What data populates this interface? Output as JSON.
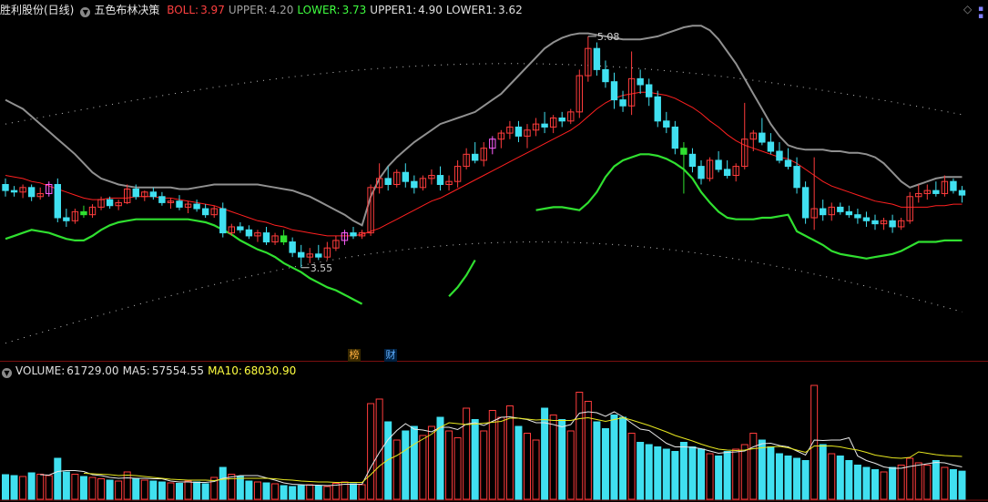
{
  "header": {
    "stock": "胜利股份(日线)",
    "indicator": "五色布林决策",
    "items": [
      {
        "label": "BOLL:",
        "value": "3.97",
        "color": "#ff4040"
      },
      {
        "label": "UPPER:",
        "value": "4.20",
        "color": "#a0a0a0"
      },
      {
        "label": "LOWER:",
        "value": "3.73",
        "color": "#40ff40"
      },
      {
        "label": "UPPER1:",
        "value": "4.90",
        "color": "#e0e0e0"
      },
      {
        "label": "LOWER1:",
        "value": "3.62",
        "color": "#e0e0e0"
      }
    ]
  },
  "volume_header": {
    "items": [
      {
        "label": "VOLUME:",
        "value": "61729.00",
        "color": "#e0e0e0"
      },
      {
        "label": "MA5:",
        "value": "57554.55",
        "color": "#e0e0e0"
      },
      {
        "label": "MA10:",
        "value": "68030.90",
        "color": "#ffff40"
      }
    ]
  },
  "badges": [
    "榜",
    "财"
  ],
  "colors": {
    "up": "#ff3c3c",
    "down": "#40e0f0",
    "ma": "#ff2020",
    "upper": "#909090",
    "lower": "#30e030",
    "vol_ma10": "#e8e820"
  },
  "chart_data": {
    "type": "candlestick",
    "annotations": {
      "high": "5.08",
      "low": "3.55"
    },
    "price_range": [
      3.0,
      5.2
    ],
    "candles": [
      [
        4.1,
        4.14,
        4.02,
        4.06
      ],
      [
        4.06,
        4.09,
        4.02,
        4.05
      ],
      [
        4.05,
        4.1,
        4.01,
        4.08
      ],
      [
        4.08,
        4.1,
        3.99,
        4.02
      ],
      [
        4.02,
        4.08,
        4.0,
        4.04
      ],
      [
        4.04,
        4.12,
        4.02,
        4.1
      ],
      [
        4.1,
        4.14,
        3.85,
        3.88
      ],
      [
        3.88,
        3.94,
        3.82,
        3.86
      ],
      [
        3.86,
        3.94,
        3.84,
        3.92
      ],
      [
        3.92,
        3.96,
        3.88,
        3.9
      ],
      [
        3.9,
        3.97,
        3.88,
        3.95
      ],
      [
        3.95,
        4.02,
        3.93,
        4.0
      ],
      [
        4.0,
        4.02,
        3.94,
        3.96
      ],
      [
        3.96,
        4.0,
        3.93,
        3.98
      ],
      [
        3.98,
        4.1,
        3.97,
        4.07
      ],
      [
        4.07,
        4.1,
        4.0,
        4.02
      ],
      [
        4.02,
        4.06,
        3.99,
        4.05
      ],
      [
        4.05,
        4.08,
        4.0,
        4.02
      ],
      [
        4.02,
        4.05,
        3.96,
        3.98
      ],
      [
        3.98,
        4.01,
        3.94,
        3.99
      ],
      [
        3.99,
        4.03,
        3.93,
        3.95
      ],
      [
        3.95,
        3.99,
        3.91,
        3.97
      ],
      [
        3.97,
        4.0,
        3.92,
        3.94
      ],
      [
        3.94,
        3.97,
        3.88,
        3.9
      ],
      [
        3.9,
        3.96,
        3.88,
        3.94
      ],
      [
        3.94,
        3.98,
        3.75,
        3.78
      ],
      [
        3.78,
        3.84,
        3.76,
        3.82
      ],
      [
        3.82,
        3.85,
        3.78,
        3.8
      ],
      [
        3.8,
        3.83,
        3.74,
        3.76
      ],
      [
        3.76,
        3.8,
        3.72,
        3.78
      ],
      [
        3.78,
        3.82,
        3.7,
        3.72
      ],
      [
        3.72,
        3.78,
        3.7,
        3.76
      ],
      [
        3.76,
        3.8,
        3.7,
        3.72
      ],
      [
        3.72,
        3.75,
        3.62,
        3.65
      ],
      [
        3.65,
        3.7,
        3.55,
        3.62
      ],
      [
        3.62,
        3.68,
        3.58,
        3.64
      ],
      [
        3.64,
        3.7,
        3.6,
        3.62
      ],
      [
        3.62,
        3.72,
        3.6,
        3.68
      ],
      [
        3.68,
        3.76,
        3.66,
        3.73
      ],
      [
        3.73,
        3.8,
        3.7,
        3.78
      ],
      [
        3.78,
        3.82,
        3.74,
        3.76
      ],
      [
        3.76,
        3.8,
        3.74,
        3.78
      ],
      [
        3.78,
        4.1,
        3.76,
        4.08
      ],
      [
        4.08,
        4.24,
        4.04,
        4.14
      ],
      [
        4.14,
        4.22,
        4.06,
        4.1
      ],
      [
        4.1,
        4.2,
        4.08,
        4.18
      ],
      [
        4.18,
        4.24,
        4.08,
        4.12
      ],
      [
        4.12,
        4.16,
        4.04,
        4.08
      ],
      [
        4.08,
        4.16,
        4.06,
        4.14
      ],
      [
        4.14,
        4.2,
        4.1,
        4.16
      ],
      [
        4.16,
        4.22,
        4.06,
        4.1
      ],
      [
        4.1,
        4.16,
        4.06,
        4.12
      ],
      [
        4.12,
        4.26,
        4.08,
        4.22
      ],
      [
        4.22,
        4.34,
        4.2,
        4.3
      ],
      [
        4.3,
        4.38,
        4.24,
        4.26
      ],
      [
        4.26,
        4.38,
        4.22,
        4.34
      ],
      [
        4.34,
        4.42,
        4.3,
        4.4
      ],
      [
        4.4,
        4.46,
        4.34,
        4.44
      ],
      [
        4.44,
        4.52,
        4.4,
        4.48
      ],
      [
        4.48,
        4.52,
        4.38,
        4.42
      ],
      [
        4.42,
        4.5,
        4.34,
        4.46
      ],
      [
        4.46,
        4.54,
        4.42,
        4.5
      ],
      [
        4.5,
        4.58,
        4.44,
        4.48
      ],
      [
        4.48,
        4.56,
        4.44,
        4.54
      ],
      [
        4.54,
        4.58,
        4.48,
        4.52
      ],
      [
        4.52,
        4.6,
        4.5,
        4.58
      ],
      [
        4.58,
        4.86,
        4.54,
        4.82
      ],
      [
        4.82,
        5.08,
        4.78,
        5.0
      ],
      [
        5.0,
        5.04,
        4.82,
        4.86
      ],
      [
        4.86,
        4.92,
        4.74,
        4.78
      ],
      [
        4.78,
        4.84,
        4.6,
        4.66
      ],
      [
        4.66,
        4.72,
        4.58,
        4.62
      ],
      [
        4.62,
        4.98,
        4.56,
        4.8
      ],
      [
        4.8,
        4.86,
        4.7,
        4.76
      ],
      [
        4.76,
        4.8,
        4.62,
        4.68
      ],
      [
        4.68,
        4.72,
        4.48,
        4.52
      ],
      [
        4.52,
        4.58,
        4.44,
        4.48
      ],
      [
        4.48,
        4.52,
        4.3,
        4.34
      ],
      [
        4.34,
        4.38,
        4.04,
        4.3
      ],
      [
        4.3,
        4.34,
        4.18,
        4.22
      ],
      [
        4.22,
        4.26,
        4.1,
        4.14
      ],
      [
        4.14,
        4.28,
        4.12,
        4.26
      ],
      [
        4.26,
        4.32,
        4.18,
        4.2
      ],
      [
        4.2,
        4.26,
        4.14,
        4.16
      ],
      [
        4.16,
        4.24,
        4.12,
        4.22
      ],
      [
        4.22,
        4.64,
        4.2,
        4.4
      ],
      [
        4.4,
        4.46,
        4.32,
        4.44
      ],
      [
        4.44,
        4.54,
        4.36,
        4.38
      ],
      [
        4.38,
        4.44,
        4.3,
        4.32
      ],
      [
        4.32,
        4.38,
        4.24,
        4.26
      ],
      [
        4.26,
        4.34,
        4.2,
        4.22
      ],
      [
        4.22,
        4.28,
        4.04,
        4.08
      ],
      [
        4.08,
        4.12,
        3.84,
        3.88
      ],
      [
        3.88,
        4.28,
        3.8,
        3.94
      ],
      [
        3.94,
        4.0,
        3.86,
        3.9
      ],
      [
        3.9,
        3.98,
        3.86,
        3.95
      ],
      [
        3.95,
        3.98,
        3.9,
        3.92
      ],
      [
        3.92,
        3.96,
        3.88,
        3.9
      ],
      [
        3.9,
        3.94,
        3.84,
        3.88
      ],
      [
        3.88,
        3.92,
        3.82,
        3.86
      ],
      [
        3.86,
        3.9,
        3.8,
        3.84
      ],
      [
        3.84,
        3.88,
        3.8,
        3.86
      ],
      [
        3.86,
        3.9,
        3.78,
        3.82
      ],
      [
        3.82,
        3.88,
        3.8,
        3.86
      ],
      [
        3.86,
        4.05,
        3.84,
        4.02
      ],
      [
        4.02,
        4.1,
        3.98,
        4.04
      ],
      [
        4.04,
        4.1,
        4.0,
        4.06
      ],
      [
        4.06,
        4.12,
        4.02,
        4.04
      ],
      [
        4.04,
        4.16,
        4.02,
        4.12
      ],
      [
        4.12,
        4.14,
        4.04,
        4.06
      ],
      [
        4.06,
        4.09,
        3.98,
        4.03
      ]
    ],
    "ma": [
      4.16,
      4.15,
      4.14,
      4.12,
      4.11,
      4.09,
      4.07,
      4.05,
      4.03,
      4.01,
      4.0,
      4.0,
      4.01,
      4.01,
      4.01,
      4.02,
      4.02,
      4.02,
      4.01,
      4.01,
      4.0,
      3.99,
      3.98,
      3.97,
      3.96,
      3.94,
      3.92,
      3.9,
      3.88,
      3.86,
      3.85,
      3.83,
      3.82,
      3.8,
      3.79,
      3.78,
      3.77,
      3.76,
      3.76,
      3.76,
      3.76,
      3.77,
      3.79,
      3.81,
      3.84,
      3.87,
      3.9,
      3.93,
      3.96,
      3.99,
      4.01,
      4.04,
      4.07,
      4.1,
      4.13,
      4.16,
      4.19,
      4.22,
      4.25,
      4.28,
      4.31,
      4.34,
      4.37,
      4.4,
      4.43,
      4.46,
      4.5,
      4.55,
      4.6,
      4.64,
      4.67,
      4.69,
      4.7,
      4.71,
      4.71,
      4.7,
      4.69,
      4.67,
      4.64,
      4.61,
      4.57,
      4.52,
      4.48,
      4.43,
      4.39,
      4.36,
      4.34,
      4.32,
      4.3,
      4.28,
      4.27,
      4.24,
      4.2,
      4.16,
      4.12,
      4.09,
      4.07,
      4.05,
      4.03,
      4.01,
      3.99,
      3.98,
      3.97,
      3.95,
      3.95,
      3.95,
      3.95,
      3.96,
      3.96,
      3.97,
      3.97
    ],
    "upper": [
      4.66,
      4.63,
      4.6,
      4.55,
      4.5,
      4.45,
      4.4,
      4.35,
      4.3,
      4.24,
      4.18,
      4.14,
      4.12,
      4.1,
      4.09,
      4.08,
      4.08,
      4.08,
      4.08,
      4.08,
      4.07,
      4.07,
      4.08,
      4.09,
      4.1,
      4.1,
      4.1,
      4.1,
      4.1,
      4.1,
      4.09,
      4.08,
      4.07,
      4.06,
      4.04,
      4.02,
      3.99,
      3.96,
      3.93,
      3.9,
      3.86,
      3.83,
      4.02,
      4.14,
      4.22,
      4.28,
      4.33,
      4.38,
      4.42,
      4.46,
      4.5,
      4.52,
      4.54,
      4.56,
      4.58,
      4.62,
      4.66,
      4.7,
      4.76,
      4.82,
      4.88,
      4.94,
      5.0,
      5.04,
      5.07,
      5.09,
      5.1,
      5.1,
      5.09,
      5.08,
      5.07,
      5.06,
      5.06,
      5.06,
      5.07,
      5.08,
      5.1,
      5.12,
      5.14,
      5.15,
      5.15,
      5.12,
      5.06,
      4.98,
      4.9,
      4.8,
      4.7,
      4.6,
      4.5,
      4.42,
      4.36,
      4.34,
      4.33,
      4.33,
      4.33,
      4.32,
      4.32,
      4.31,
      4.31,
      4.3,
      4.28,
      4.24,
      4.18,
      4.12,
      4.08,
      4.1,
      4.12,
      4.14,
      4.15,
      4.15,
      4.15
    ],
    "lower": [
      3.74,
      3.76,
      3.78,
      3.8,
      3.79,
      3.78,
      3.76,
      3.74,
      3.73,
      3.73,
      3.76,
      3.8,
      3.83,
      3.85,
      3.86,
      3.87,
      3.87,
      3.87,
      3.87,
      3.87,
      3.87,
      3.87,
      3.86,
      3.85,
      3.83,
      3.8,
      3.77,
      3.73,
      3.7,
      3.67,
      3.65,
      3.62,
      3.58,
      3.55,
      3.52,
      3.48,
      3.45,
      3.42,
      3.4,
      3.37,
      3.34,
      3.31,
      null,
      null,
      null,
      null,
      null,
      null,
      null,
      null,
      null,
      3.36,
      3.42,
      3.5,
      3.6,
      null,
      null,
      null,
      null,
      null,
      null,
      3.93,
      3.94,
      3.95,
      3.95,
      3.94,
      3.93,
      3.98,
      4.05,
      4.15,
      4.22,
      4.26,
      4.28,
      4.3,
      4.3,
      4.29,
      4.27,
      4.24,
      4.2,
      4.14,
      4.05,
      3.98,
      3.92,
      3.88,
      3.87,
      3.87,
      3.87,
      3.88,
      3.88,
      3.89,
      3.9,
      3.79,
      3.76,
      3.73,
      3.7,
      3.66,
      3.64,
      3.63,
      3.62,
      3.61,
      3.62,
      3.63,
      3.64,
      3.66,
      3.69,
      3.72,
      3.72,
      3.72,
      3.73,
      3.73,
      3.73
    ],
    "upper1_range": [
      3.05,
      4.9
    ],
    "volume": [
      54,
      52,
      50,
      58,
      55,
      52,
      90,
      60,
      55,
      50,
      48,
      45,
      42,
      40,
      60,
      45,
      42,
      40,
      38,
      36,
      35,
      40,
      38,
      34,
      48,
      70,
      55,
      50,
      40,
      38,
      36,
      34,
      30,
      28,
      30,
      32,
      30,
      28,
      35,
      38,
      34,
      32,
      210,
      220,
      170,
      130,
      150,
      160,
      140,
      160,
      180,
      150,
      135,
      200,
      175,
      150,
      195,
      180,
      205,
      160,
      145,
      130,
      200,
      185,
      175,
      150,
      235,
      215,
      170,
      155,
      185,
      180,
      145,
      125,
      120,
      115,
      110,
      105,
      125,
      115,
      110,
      100,
      95,
      105,
      110,
      120,
      145,
      130,
      115,
      100,
      95,
      90,
      85,
      250,
      120,
      100,
      95,
      85,
      75,
      70,
      65,
      60,
      70,
      75,
      90,
      80,
      75,
      85,
      70,
      65,
      61.7
    ],
    "vol_ma5": [
      null,
      null,
      null,
      null,
      54,
      53,
      61,
      63,
      63,
      61,
      54,
      52,
      48,
      46,
      47,
      46,
      46,
      45,
      45,
      40,
      38,
      38,
      37,
      37,
      39,
      46,
      49,
      52,
      52,
      52,
      47,
      42,
      36,
      33,
      32,
      31,
      31,
      30,
      31,
      33,
      33,
      33,
      70,
      103,
      131,
      151,
      166,
      154,
      152,
      148,
      158,
      158,
      153,
      165,
      168,
      162,
      171,
      180,
      181,
      178,
      175,
      168,
      168,
      164,
      159,
      164,
      189,
      192,
      190,
      182,
      192,
      181,
      167,
      154,
      151,
      137,
      123,
      115,
      115,
      114,
      111,
      106,
      101,
      103,
      104,
      106,
      115,
      122,
      123,
      118,
      115,
      106,
      97,
      130,
      129,
      130,
      130,
      135,
      95,
      85,
      79,
      71,
      68,
      68,
      72,
      75,
      78,
      81,
      80,
      75,
      71
    ],
    "vol_ma10": [
      null,
      null,
      null,
      null,
      null,
      null,
      null,
      null,
      null,
      57,
      56,
      55,
      54,
      52,
      53,
      52,
      50,
      48,
      46,
      44,
      43,
      42,
      42,
      42,
      41,
      44,
      45,
      46,
      46,
      46,
      46,
      45,
      43,
      42,
      40,
      39,
      38,
      38,
      37,
      37,
      37,
      37,
      54,
      73,
      87,
      96,
      108,
      121,
      132,
      143,
      158,
      168,
      166,
      164,
      165,
      167,
      169,
      171,
      178,
      178,
      176,
      174,
      175,
      173,
      173,
      173,
      177,
      179,
      175,
      171,
      175,
      179,
      174,
      168,
      162,
      155,
      148,
      140,
      134,
      128,
      121,
      115,
      110,
      108,
      107,
      108,
      111,
      113,
      115,
      116,
      113,
      108,
      103,
      117,
      117,
      117,
      115,
      111,
      108,
      103,
      97,
      94,
      91,
      90,
      92,
      104,
      101,
      98,
      96,
      95,
      94
    ]
  }
}
